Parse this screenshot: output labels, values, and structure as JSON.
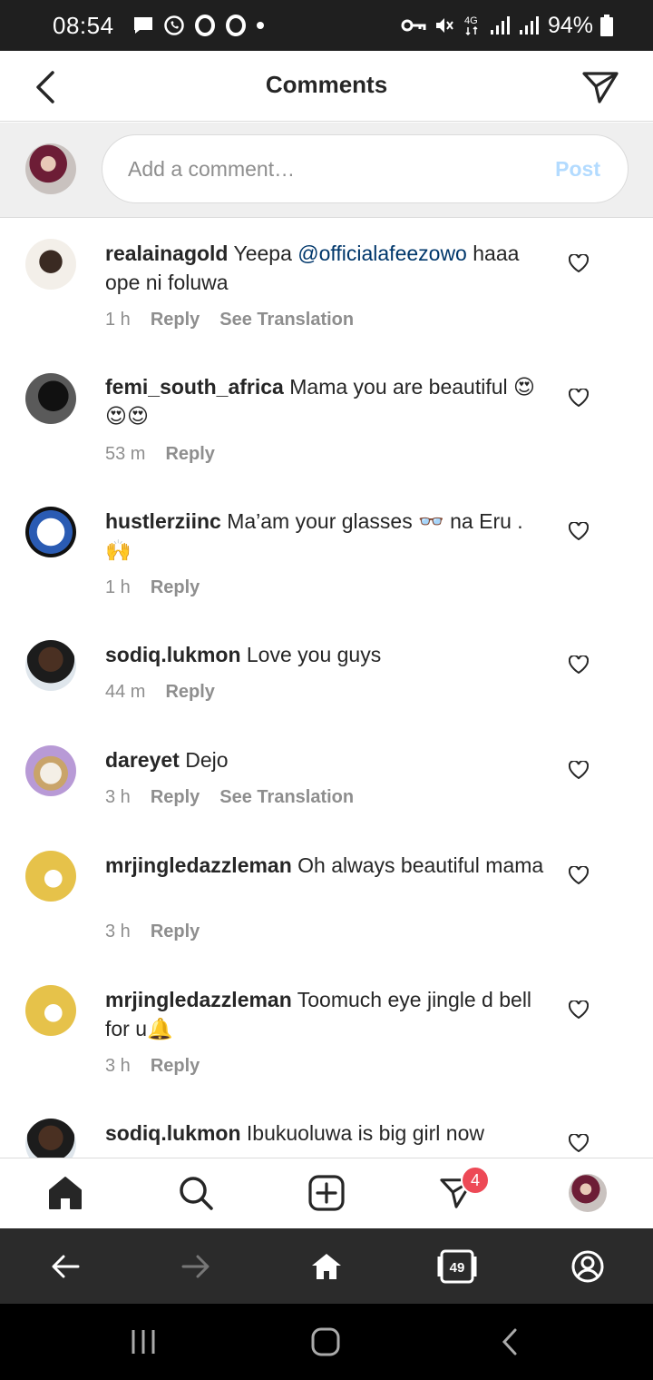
{
  "status_bar": {
    "time": "08:54",
    "network": "4G",
    "battery": "94%"
  },
  "header": {
    "title": "Comments"
  },
  "composer": {
    "placeholder": "Add a comment…",
    "post_label": "Post"
  },
  "comments": [
    {
      "user": "realainagold",
      "text_before": "Yeepa ",
      "mention": "@officialafeezowo",
      "text_after": " haaa ope ni foluwa",
      "time": "1 h",
      "reply": "Reply",
      "translate": "See Translation"
    },
    {
      "user": "femi_south_africa",
      "text_before": "Mama you are beautiful 😍😍😍",
      "mention": "",
      "text_after": "",
      "time": "53 m",
      "reply": "Reply",
      "translate": ""
    },
    {
      "user": "hustlerziinc",
      "text_before": "Ma’am your glasses 👓 na Eru . 🙌",
      "mention": "",
      "text_after": "",
      "time": "1 h",
      "reply": "Reply",
      "translate": ""
    },
    {
      "user": "sodiq.lukmon",
      "text_before": "Love you guys",
      "mention": "",
      "text_after": "",
      "time": "44 m",
      "reply": "Reply",
      "translate": ""
    },
    {
      "user": "dareyet",
      "text_before": "Dejo",
      "mention": "",
      "text_after": "",
      "time": "3 h",
      "reply": "Reply",
      "translate": "See Translation"
    },
    {
      "user": "mrjingledazzleman",
      "text_before": "Oh always beautiful mama",
      "mention": "",
      "text_after": "",
      "time": "3 h",
      "reply": "Reply",
      "translate": ""
    },
    {
      "user": "mrjingledazzleman",
      "text_before": "Toomuch eye jingle d bell for u🔔",
      "mention": "",
      "text_after": "",
      "time": "3 h",
      "reply": "Reply",
      "translate": ""
    },
    {
      "user": "sodiq.lukmon",
      "text_before": "Ibukuoluwa is big girl now",
      "mention": "",
      "text_after": "",
      "time": "",
      "reply": "",
      "translate": ""
    }
  ],
  "bottom_nav": {
    "notification_count": "4"
  },
  "browser_bar": {
    "tab_count": "49"
  },
  "colors": {
    "accent_link": "#00376b",
    "post_disabled": "#b3dbff",
    "badge": "#ed4956"
  },
  "icons": [
    "back-arrow-icon",
    "direct-send-icon",
    "heart-icon",
    "home-icon",
    "search-icon",
    "new-post-icon",
    "activity-icon",
    "browser-back-icon",
    "browser-forward-icon",
    "browser-home-icon",
    "tabs-icon",
    "account-icon",
    "recents-icon",
    "system-home-icon",
    "system-back-icon"
  ]
}
